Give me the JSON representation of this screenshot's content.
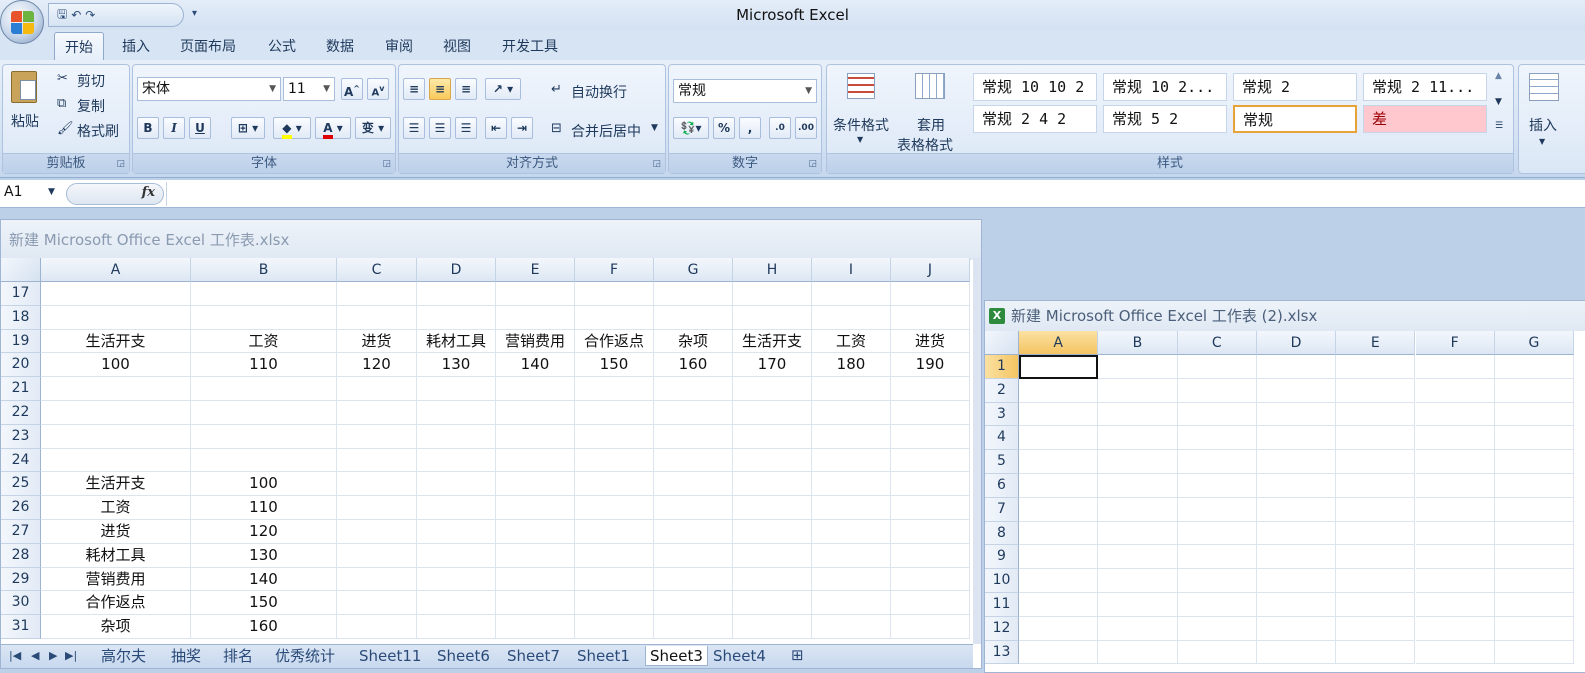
{
  "app": {
    "title": "Microsoft Excel"
  },
  "qat": {
    "save": "🖫",
    "undo": "↶",
    "redo": "↷",
    "more": "▾"
  },
  "tabs": [
    "开始",
    "插入",
    "页面布局",
    "公式",
    "数据",
    "审阅",
    "视图",
    "开发工具"
  ],
  "clipboard": {
    "paste": "粘贴",
    "cut": "剪切",
    "copy": "复制",
    "format_painter": "格式刷",
    "label": "剪贴板"
  },
  "font": {
    "name": "宋体",
    "size": "11",
    "label": "字体",
    "bold": "B",
    "italic": "I",
    "underline": "U",
    "grow": "A",
    "shrink": "A",
    "phonetic": "变"
  },
  "alignment": {
    "wrap": "自动换行",
    "merge": "合并后居中",
    "label": "对齐方式"
  },
  "number": {
    "format": "常规",
    "percent": "%",
    "comma": ",",
    "label": "数字"
  },
  "styles": {
    "conditional": "条件格式",
    "table_format_1": "套用",
    "table_format_2": "表格格式",
    "label": "样式",
    "gallery": [
      "常规 10 10 2",
      "常规 10 2...",
      "常规 2",
      "常规 2 11...",
      "常规 2 4 2",
      "常规 5 2",
      "常规",
      "差"
    ]
  },
  "cells_group": {
    "insert": "插入"
  },
  "formula_bar": {
    "name_box": "A1",
    "fx": "fx",
    "value": ""
  },
  "workbook1": {
    "title": "新建 Microsoft Office Excel 工作表.xlsx",
    "columns": [
      "A",
      "B",
      "C",
      "D",
      "E",
      "F",
      "G",
      "H",
      "I",
      "J"
    ],
    "rows": [
      {
        "num": "17",
        "cells": [
          "",
          "",
          "",
          "",
          "",
          "",
          "",
          "",
          "",
          ""
        ]
      },
      {
        "num": "18",
        "cells": [
          "",
          "",
          "",
          "",
          "",
          "",
          "",
          "",
          "",
          ""
        ]
      },
      {
        "num": "19",
        "cells": [
          "生活开支",
          "工资",
          "进货",
          "耗材工具",
          "营销费用",
          "合作返点",
          "杂项",
          "生活开支",
          "工资",
          "进货"
        ]
      },
      {
        "num": "20",
        "cells": [
          "100",
          "110",
          "120",
          "130",
          "140",
          "150",
          "160",
          "170",
          "180",
          "190"
        ]
      },
      {
        "num": "21",
        "cells": [
          "",
          "",
          "",
          "",
          "",
          "",
          "",
          "",
          "",
          ""
        ]
      },
      {
        "num": "22",
        "cells": [
          "",
          "",
          "",
          "",
          "",
          "",
          "",
          "",
          "",
          ""
        ]
      },
      {
        "num": "23",
        "cells": [
          "",
          "",
          "",
          "",
          "",
          "",
          "",
          "",
          "",
          ""
        ]
      },
      {
        "num": "24",
        "cells": [
          "",
          "",
          "",
          "",
          "",
          "",
          "",
          "",
          "",
          ""
        ]
      },
      {
        "num": "25",
        "cells": [
          "生活开支",
          "100",
          "",
          "",
          "",
          "",
          "",
          "",
          "",
          ""
        ]
      },
      {
        "num": "26",
        "cells": [
          "工资",
          "110",
          "",
          "",
          "",
          "",
          "",
          "",
          "",
          ""
        ]
      },
      {
        "num": "27",
        "cells": [
          "进货",
          "120",
          "",
          "",
          "",
          "",
          "",
          "",
          "",
          ""
        ]
      },
      {
        "num": "28",
        "cells": [
          "耗材工具",
          "130",
          "",
          "",
          "",
          "",
          "",
          "",
          "",
          ""
        ]
      },
      {
        "num": "29",
        "cells": [
          "营销费用",
          "140",
          "",
          "",
          "",
          "",
          "",
          "",
          "",
          ""
        ]
      },
      {
        "num": "30",
        "cells": [
          "合作返点",
          "150",
          "",
          "",
          "",
          "",
          "",
          "",
          "",
          ""
        ]
      },
      {
        "num": "31",
        "cells": [
          "杂项",
          "160",
          "",
          "",
          "",
          "",
          "",
          "",
          "",
          ""
        ]
      }
    ],
    "sheet_tabs": [
      "高尔夫",
      "抽奖",
      "排名",
      "优秀统计",
      "Sheet11",
      "Sheet6",
      "Sheet7",
      "Sheet1",
      "Sheet3",
      "Sheet4"
    ],
    "active_sheet": "Sheet3"
  },
  "workbook2": {
    "title": "新建 Microsoft Office Excel 工作表 (2).xlsx",
    "columns": [
      "A",
      "B",
      "C",
      "D",
      "E",
      "F",
      "G"
    ],
    "rows": [
      "1",
      "2",
      "3",
      "4",
      "5",
      "6",
      "7",
      "8",
      "9",
      "10",
      "11",
      "12",
      "13"
    ]
  }
}
